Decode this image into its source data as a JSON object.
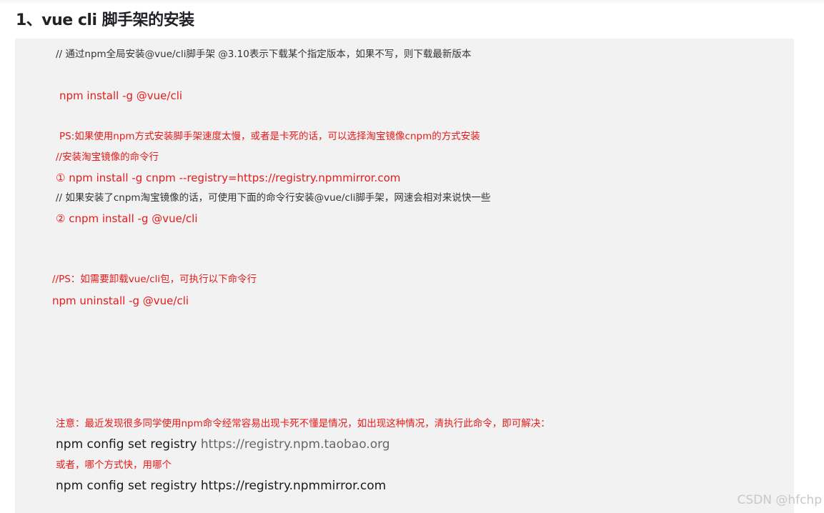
{
  "heading": "1、vue cli 脚手架的安装",
  "lines": {
    "comment_intro": "//  通过npm全局安装@vue/cli脚手架  @3.10表示下载某个指定版本，如果不写，则下载最新版本",
    "cmd_install": "npm install -g @vue/cli",
    "ps_note": "PS:如果使用npm方式安装脚手架速度太慢，或者是卡死的话，可以选择淘宝镜像cnpm的方式安装",
    "comment_taobao": "//安装淘宝镜像的命令行",
    "cmd_cnpm_registry": "①  npm install -g cnpm --registry=https://registry.npmmirror.com",
    "comment_cnpm": "// 如果安装了cnpm淘宝镜像的话，可使用下面的命令行安装@vue/cli脚手架，网速会相对来说快一些",
    "cmd_cnpm_install": "②  cnpm install -g @vue/cli",
    "ps_uninstall": "//PS：如需要卸载vue/cli包，可执行以下命令行",
    "cmd_uninstall": "npm uninstall -g @vue/cli",
    "notice": "注意：最近发现很多同学使用npm命令经常容易出现卡死不懂是情况，如出现这种情况，清执行此命令，即可解决：",
    "cmd_config_prefix": "npm config set registry ",
    "cmd_config_url": "https://registry.npm.taobao.org",
    "or_note": "或者，哪个方式快，用哪个",
    "cmd_config_mirror": "npm config set registry https://registry.npmmirror.com"
  },
  "watermark": "CSDN @hfchp",
  "colors": {
    "block_bg": "#f2f2f2",
    "red_text": "#e51a1a",
    "heading_text": "#222226"
  }
}
